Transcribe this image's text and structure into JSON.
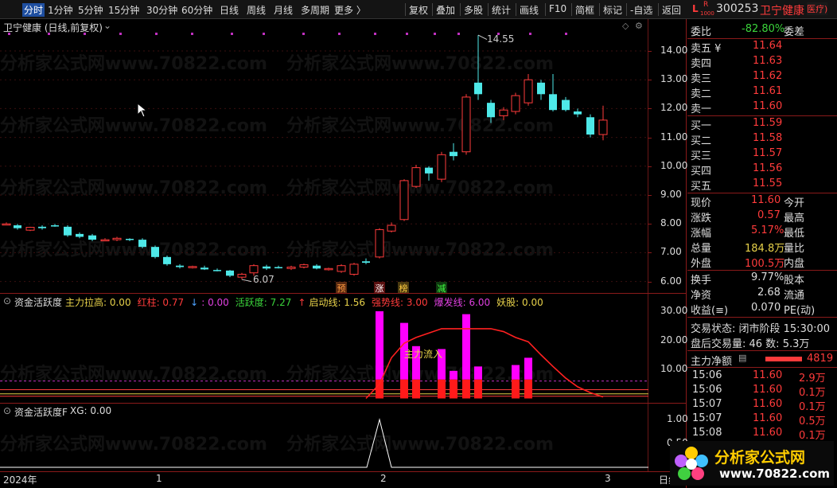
{
  "toolbar": {
    "periods": [
      "分时",
      "1分钟",
      "5分钟",
      "15分钟",
      "30分钟",
      "60分钟",
      "日线",
      "周线",
      "月线",
      "多周期",
      "更多 〉"
    ],
    "tools": [
      "复权",
      "叠加",
      "多股",
      "统计",
      "画线",
      "F10",
      "简框",
      "标记",
      "-自选",
      "返回"
    ],
    "badge_l": "L",
    "badge_r": "R",
    "badge_sub": "1000",
    "code": "300253",
    "name": "卫宁健康"
  },
  "main_chart": {
    "title": "卫宁健康 (日线,前复权)",
    "high_label": "14.55",
    "low_label": "6.07",
    "yticks": [
      "14.00",
      "13.00",
      "12.00",
      "11.00",
      "10.00",
      "9.00",
      "8.00",
      "7.00",
      "6.00"
    ],
    "signals": [
      "预",
      "涨",
      "榜",
      "减"
    ]
  },
  "indicator1": {
    "name": "资金活跃度",
    "params": [
      {
        "label": "主力拉高: 0.00",
        "color": "#e8d24a"
      },
      {
        "label": "红柱: 0.77",
        "color": "#ff3b3b"
      },
      {
        "label": "↓",
        "color": "#4ea3ff"
      },
      {
        "label": ": 0.00",
        "color": "#e040e0"
      },
      {
        "label": "活跃度: 7.27",
        "color": "#3bd43b"
      },
      {
        "label": "↑",
        "color": "#ff3b3b"
      },
      {
        "label": "启动线: 1.56",
        "color": "#e8d24a"
      },
      {
        "label": "强势线: 3.00",
        "color": "#ff3b3b"
      },
      {
        "label": "爆发线: 6.00",
        "color": "#e040e0"
      },
      {
        "label": "妖股: 0.00",
        "color": "#e8d24a"
      }
    ],
    "annotation": "主力流入",
    "yticks": [
      "30.00",
      "20.00",
      "10.00"
    ]
  },
  "indicator2": {
    "name": "资金活跃度F",
    "param": "XG: 0.00",
    "yticks": [
      "1.00",
      "0.50"
    ]
  },
  "xaxis": [
    "2024年",
    "1",
    "2",
    "3"
  ],
  "xaxis_corner": "日线",
  "right_panel": {
    "weibi_label": "委比",
    "weibi_value": "-82.80%",
    "weicha_label": "委差",
    "asks": [
      {
        "label": "卖五 ¥",
        "price": "11.64"
      },
      {
        "label": "卖四",
        "price": "11.63"
      },
      {
        "label": "卖三",
        "price": "11.62"
      },
      {
        "label": "卖二",
        "price": "11.61"
      },
      {
        "label": "卖一",
        "price": "11.60"
      }
    ],
    "bids": [
      {
        "label": "买一",
        "price": "11.59"
      },
      {
        "label": "买二",
        "price": "11.58"
      },
      {
        "label": "买三",
        "price": "11.57"
      },
      {
        "label": "买四",
        "price": "11.56"
      },
      {
        "label": "买五",
        "price": "11.55"
      }
    ],
    "stats": [
      {
        "l": "现价",
        "v": "11.60",
        "r": "今开",
        "c": "#ff3b3b"
      },
      {
        "l": "涨跌",
        "v": "0.57",
        "r": "最高",
        "c": "#ff3b3b"
      },
      {
        "l": "涨幅",
        "v": "5.17%",
        "r": "最低",
        "c": "#ff3b3b"
      },
      {
        "l": "总量",
        "v": "184.8万",
        "r": "量比",
        "c": "#e8d24a"
      },
      {
        "l": "外盘",
        "v": "100.5万",
        "r": "内盘",
        "c": "#ff3b3b"
      }
    ],
    "stats2": [
      {
        "l": "换手",
        "v": "9.77%",
        "r": "股本"
      },
      {
        "l": "净资",
        "v": "2.68",
        "r": "流通"
      },
      {
        "l": "收益(≡)",
        "v": "0.070",
        "r": "PE(动)"
      }
    ],
    "trade_status": "交易状态: 闭市阶段 15:30:00",
    "after_hours": "盘后交易量: 46   数: 5.3万",
    "net_label": "主力净额",
    "net_value": "4819",
    "sector": "医疗)",
    "ticks": [
      {
        "t": "15:06",
        "p": "11.60",
        "v": "2.9万"
      },
      {
        "t": "15:06",
        "p": "11.60",
        "v": "0.1万"
      },
      {
        "t": "15:07",
        "p": "11.60",
        "v": "0.1万"
      },
      {
        "t": "15:07",
        "p": "11.60",
        "v": "0.5万"
      },
      {
        "t": "15:08",
        "p": "11.60",
        "v": "0.1万"
      }
    ]
  },
  "watermark": "分析家公式网www.70822.com",
  "logo": {
    "text": "分析家公式网",
    "url": "www.70822.com"
  }
}
